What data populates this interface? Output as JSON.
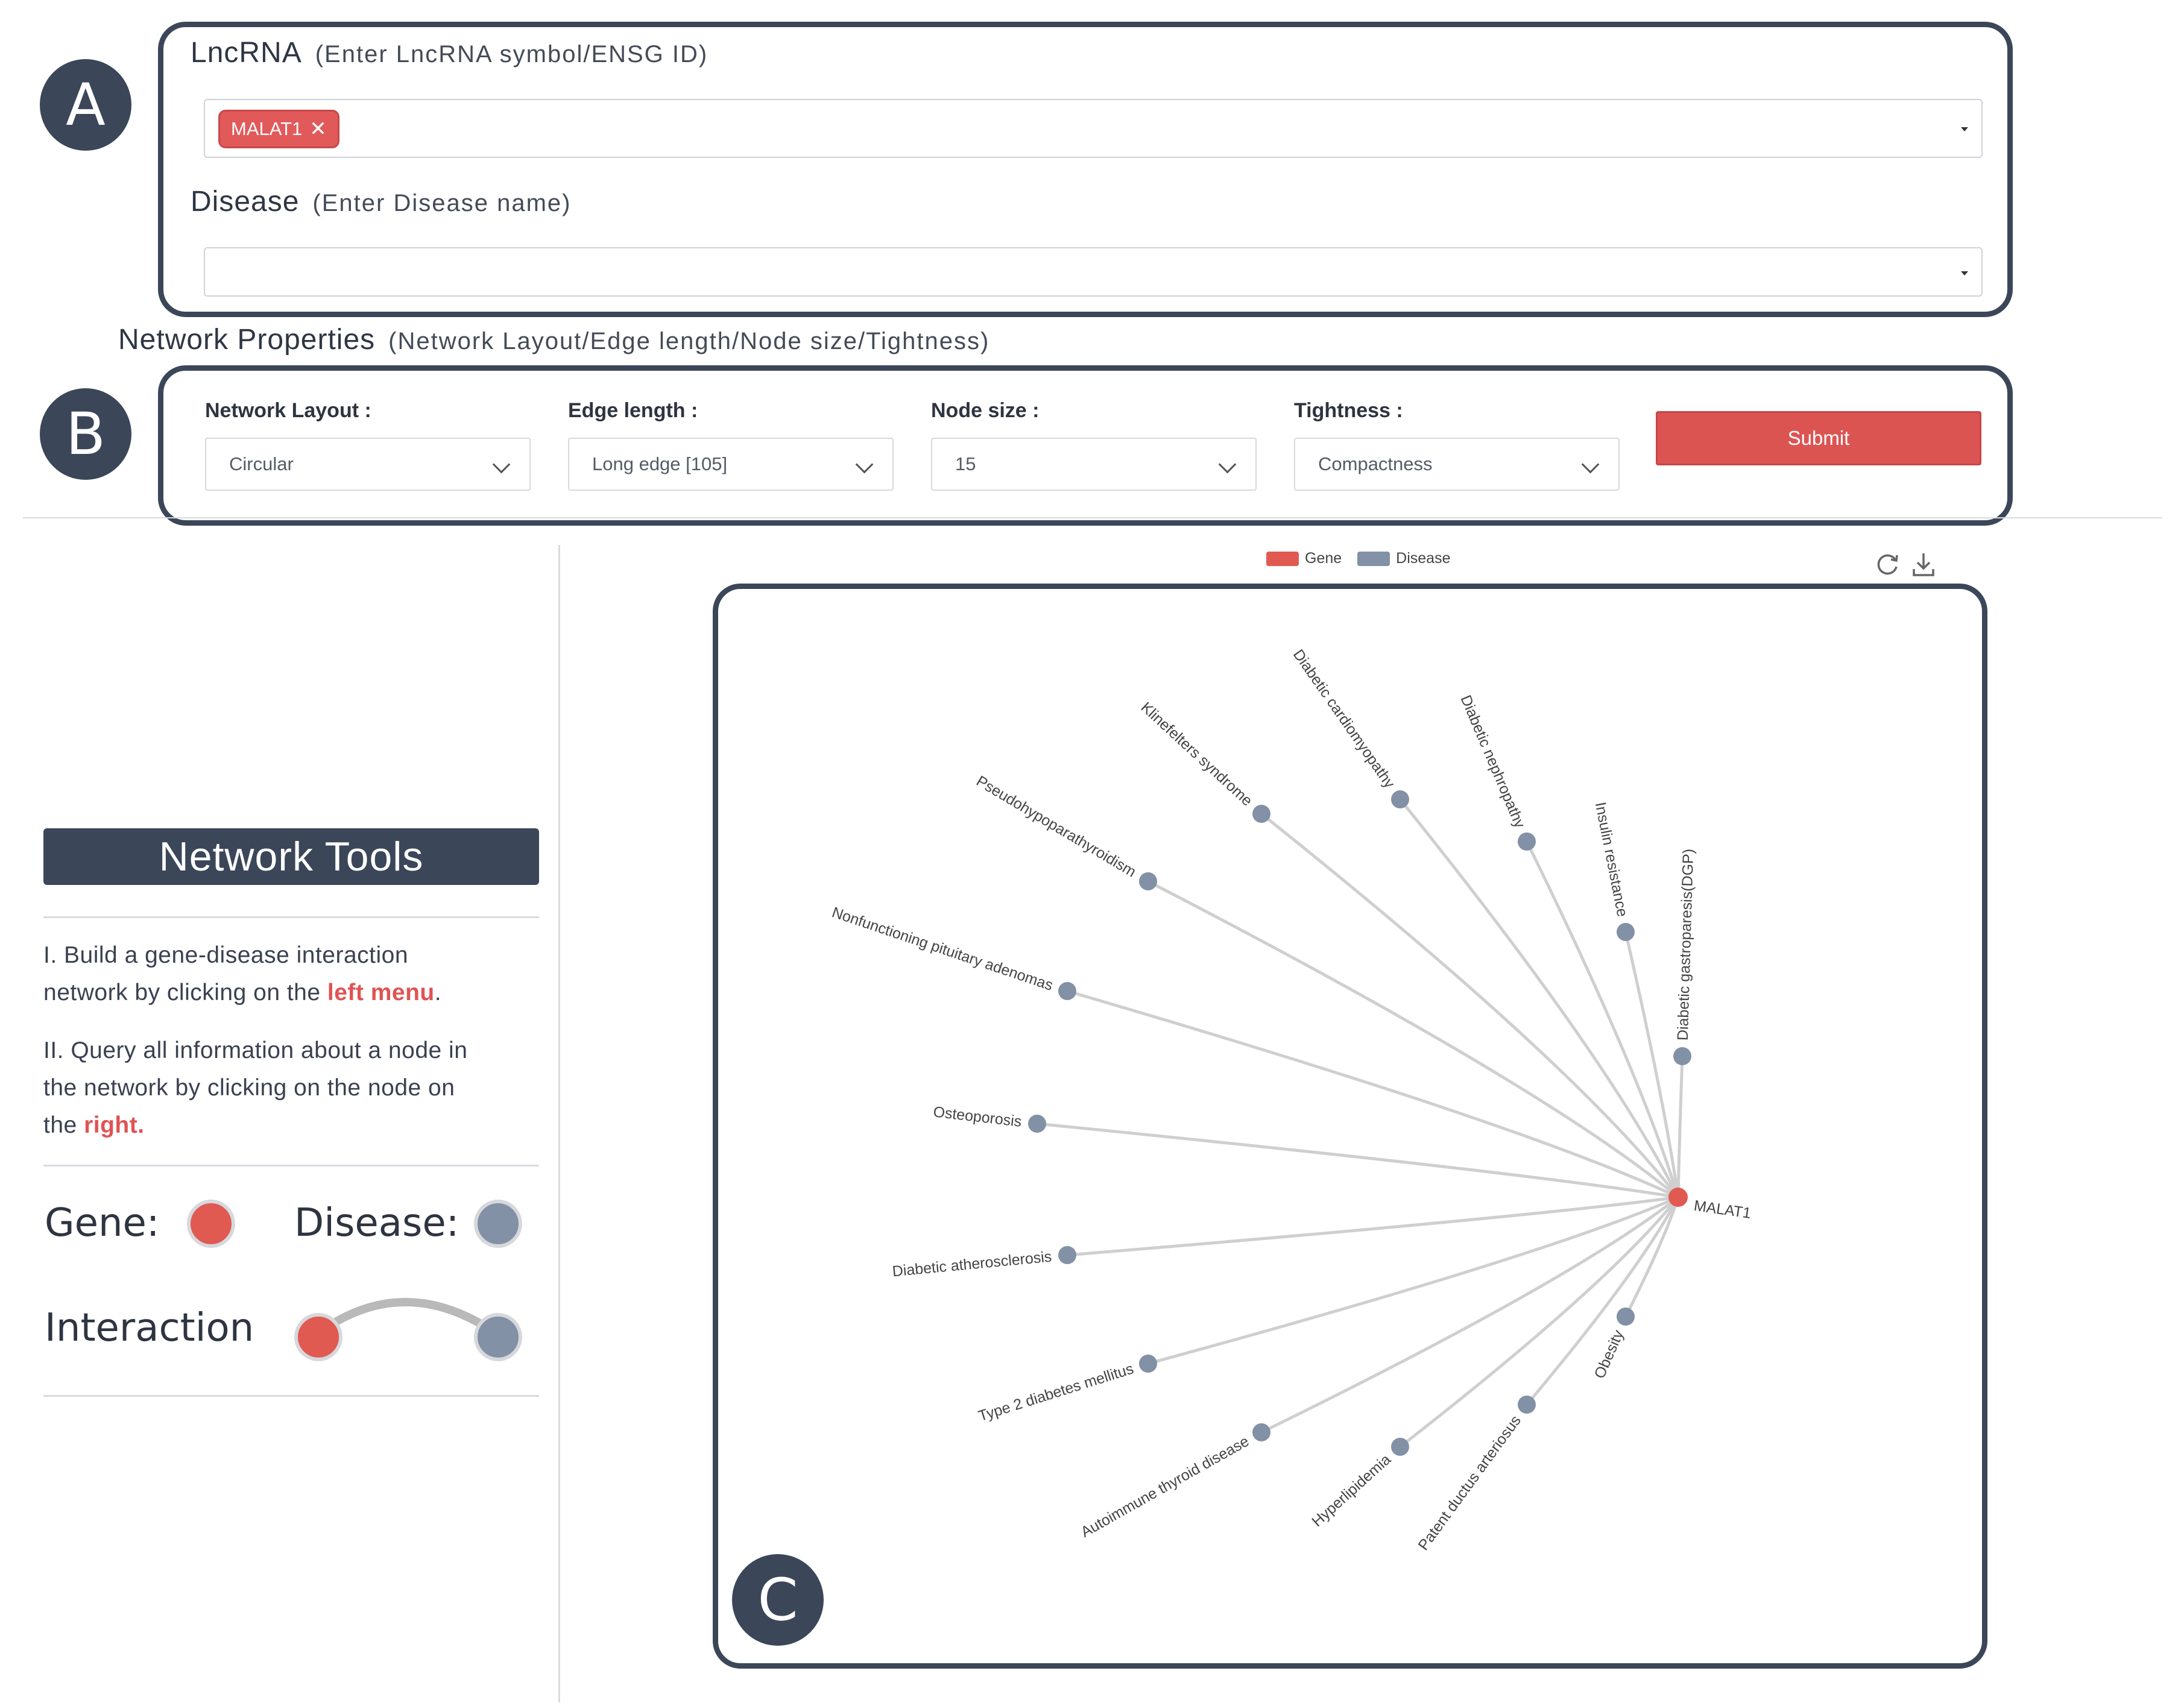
{
  "panel_a": {
    "letter": "A",
    "lncrna": {
      "title": "LncRNA",
      "hint": "(Enter LncRNA symbol/ENSG ID)",
      "tag": "MALAT1",
      "tag_close": "✕"
    },
    "disease": {
      "title": "Disease",
      "hint": "(Enter Disease name)",
      "value": ""
    }
  },
  "network_properties": {
    "title": "Network Properties",
    "hint": "(Network Layout/Edge length/Node size/Tightness)"
  },
  "panel_b": {
    "letter": "B",
    "layout": {
      "label": "Network Layout :",
      "value": "Circular"
    },
    "edge": {
      "label": "Edge length :",
      "value": "Long edge [105]"
    },
    "node_size": {
      "label": "Node size :",
      "value": "15"
    },
    "tightness": {
      "label": "Tightness :",
      "value": "Compactness"
    },
    "submit": "Submit"
  },
  "tools": {
    "title": "Network Tools",
    "line1_a": "I. Build a gene-disease interaction",
    "line1_b": "network by clicking on the ",
    "line1_red": "left menu",
    "line1_end": ".",
    "line2_a": "II. Query all information about a node in",
    "line2_b": "the network by clicking on the node on",
    "line2_c": "the ",
    "line2_red": "right.",
    "legend_gene": "Gene:",
    "legend_disease": "Disease:",
    "legend_interaction": "Interaction"
  },
  "chart_legend": {
    "gene": "Gene",
    "disease": "Disease"
  },
  "panel_c_letter": "C",
  "colors": {
    "gene": "#e05a52",
    "disease": "#8291a5",
    "panel": "#3b4659",
    "edge": "#cfcfcf"
  },
  "network": {
    "center": "MALAT1",
    "diseases": [
      "Klinefelters syndrome",
      "Diabetic cardiomyopathy",
      "Diabetic nephropathy",
      "Pseudohypoparathyroidism",
      "Insulin resistance",
      "Nonfunctioning pituitary adenomas",
      "Diabetic gastroparesis(DGP)",
      "Osteoporosis",
      "Diabetic atherosclerosis",
      "Obesity",
      "Type 2 diabetes mellitus",
      "Patent ductus arteriosus",
      "Autoimmune thyroid disease",
      "Hyperlipidemia"
    ]
  }
}
